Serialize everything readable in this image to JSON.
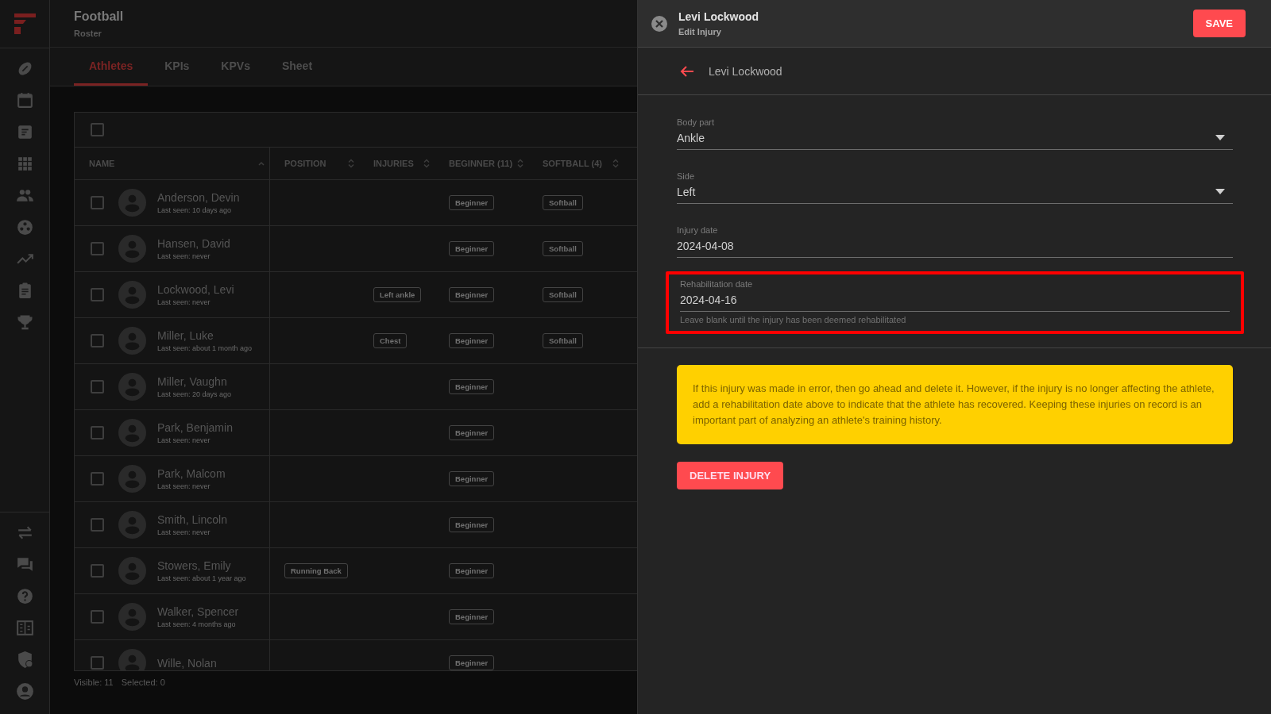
{
  "header": {
    "title": "Football",
    "subtitle": "Roster"
  },
  "tabs": [
    {
      "label": "Athletes",
      "selected": true
    },
    {
      "label": "KPIs",
      "selected": false
    },
    {
      "label": "KPVs",
      "selected": false
    },
    {
      "label": "Sheet",
      "selected": false
    }
  ],
  "table": {
    "select_all_checked": false,
    "columns": [
      {
        "label": "NAME",
        "sorted": true
      },
      {
        "label": "POSITION",
        "sorted": false
      },
      {
        "label": "INJURIES",
        "sorted": false
      },
      {
        "label": "BEGINNER (11)",
        "sorted": false
      },
      {
        "label": "SOFTBALL (4)",
        "sorted": false
      }
    ],
    "rows": [
      {
        "name": "Anderson, Devin",
        "last_seen": "Last seen: 10 days ago",
        "checked": false,
        "level": "Beginner",
        "sport": "Softball"
      },
      {
        "name": "Hansen, David",
        "last_seen": "Last seen: never",
        "checked": false,
        "level": "Beginner",
        "sport": "Softball"
      },
      {
        "name": "Lockwood, Levi",
        "last_seen": "Last seen: never",
        "checked": false,
        "injury": "Left ankle",
        "level": "Beginner",
        "sport": "Softball"
      },
      {
        "name": "Miller, Luke",
        "last_seen": "Last seen: about 1 month ago",
        "checked": false,
        "injury": "Chest",
        "level": "Beginner",
        "sport": "Softball"
      },
      {
        "name": "Miller, Vaughn",
        "last_seen": "Last seen: 20 days ago",
        "checked": false,
        "level": "Beginner"
      },
      {
        "name": "Park, Benjamin",
        "last_seen": "Last seen: never",
        "checked": false,
        "level": "Beginner"
      },
      {
        "name": "Park, Malcom",
        "last_seen": "Last seen: never",
        "checked": false,
        "level": "Beginner"
      },
      {
        "name": "Smith, Lincoln",
        "last_seen": "Last seen: never",
        "checked": false,
        "level": "Beginner"
      },
      {
        "name": "Stowers, Emily",
        "last_seen": "Last seen: about 1 year ago",
        "checked": false,
        "position": "Running Back",
        "level": "Beginner"
      },
      {
        "name": "Walker, Spencer",
        "last_seen": "Last seen: 4 months ago",
        "checked": false,
        "level": "Beginner"
      },
      {
        "name": "Wille, Nolan",
        "checked": false,
        "level": "Beginner"
      }
    ],
    "footer": {
      "visible": "Visible: 11",
      "selected": "Selected: 0"
    }
  },
  "panel": {
    "title": "Levi Lockwood",
    "subtitle": "Edit Injury",
    "save": "SAVE",
    "back_label": "Levi Lockwood",
    "fields": [
      {
        "kind": "select",
        "label": "Body part",
        "value": "Ankle"
      },
      {
        "kind": "select",
        "label": "Side",
        "value": "Left"
      },
      {
        "kind": "date",
        "label": "Injury date",
        "value": "2024-04-08"
      },
      {
        "kind": "date",
        "label": "Rehabilitation date",
        "value": "2024-04-16",
        "helper": "Leave blank until the injury has been deemed rehabilitated",
        "highlighted": true
      }
    ],
    "notice": "If this injury was made in error, then go ahead and delete it. However, if the injury is no longer affecting the athlete, add a rehabilitation date above to indicate that the athlete has recovered. Keeping these injuries on record is an important part of analyzing an athlete's training history.",
    "delete": "DELETE INJURY"
  }
}
